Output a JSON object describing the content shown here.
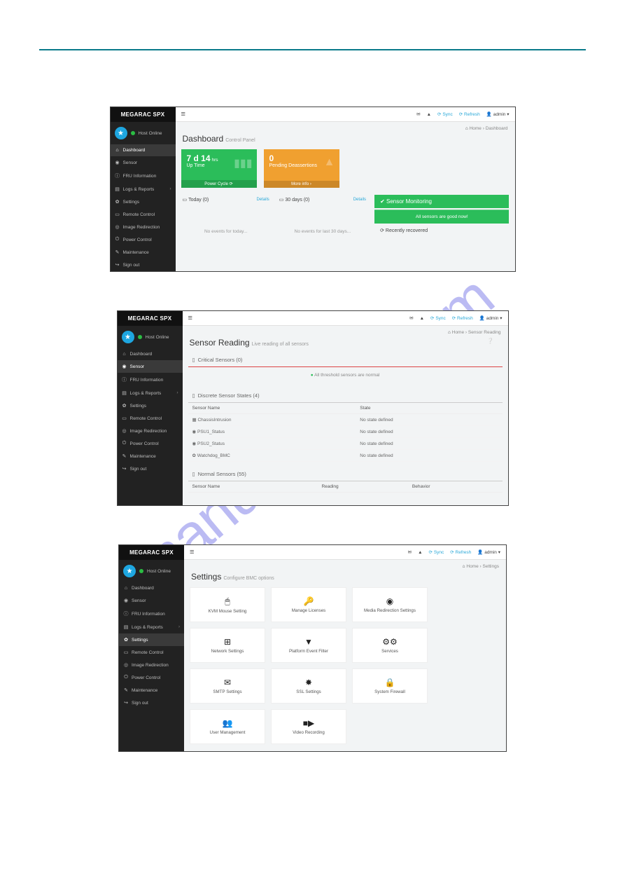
{
  "app_name": "MEGARAC SPX",
  "host": {
    "status": "Host Online"
  },
  "nav": {
    "dashboard": "Dashboard",
    "sensor": "Sensor",
    "fru": "FRU Information",
    "logs": "Logs & Reports",
    "settings": "Settings",
    "remote": "Remote Control",
    "image": "Image Redirection",
    "power": "Power Control",
    "maint": "Maintenance",
    "signout": "Sign out"
  },
  "topbar": {
    "sync": "Sync",
    "refresh": "Refresh",
    "user": "admin"
  },
  "breadcrumb": {
    "home": "Home",
    "dashboard": "Dashboard",
    "sensor": "Sensor Reading",
    "settings": "Settings"
  },
  "dash": {
    "title": "Dashboard",
    "sub": "Control Panel",
    "uptime_num": "7 d 14",
    "uptime_unit": "hrs",
    "uptime_label": "Up Time",
    "uptime_foot": "Power Cycle",
    "pending_num": "0",
    "pending_label": "Pending Deassertions",
    "pending_foot": "More info",
    "today_h": "Today (0)",
    "today_body": "No events for today...",
    "days_h": "30 days (0)",
    "days_body": "No events for last 30 days...",
    "sm_h": "Sensor Monitoring",
    "sm_ok": "All sensors are good now!",
    "recent": "Recently recovered",
    "details": "Details"
  },
  "sensor": {
    "title": "Sensor Reading",
    "sub": "Live reading of all sensors",
    "crit_h": "Critical Sensors (0)",
    "crit_body": "All threshold sensors are normal",
    "disc_h": "Discrete Sensor States (4)",
    "norm_h": "Normal Sensors (55)",
    "col_name": "Sensor Name",
    "col_state": "State",
    "col_reading": "Reading",
    "col_behavior": "Behavior",
    "rows": [
      {
        "name": "ChassisIntrusion",
        "state": "No state defined"
      },
      {
        "name": "PSU1_Status",
        "state": "No state defined"
      },
      {
        "name": "PSU2_Status",
        "state": "No state defined"
      },
      {
        "name": "Watchdog_BMC",
        "state": "No state defined"
      }
    ]
  },
  "settings": {
    "title": "Settings",
    "sub": "Configure BMC options",
    "cards": [
      "KVM Mouse Setting",
      "Manage Licenses",
      "Media Redirection Settings",
      "Network Settings",
      "Platform Event Filter",
      "Services",
      "SMTP Settings",
      "SSL Settings",
      "System Firewall",
      "User Management",
      "Video Recording"
    ]
  }
}
